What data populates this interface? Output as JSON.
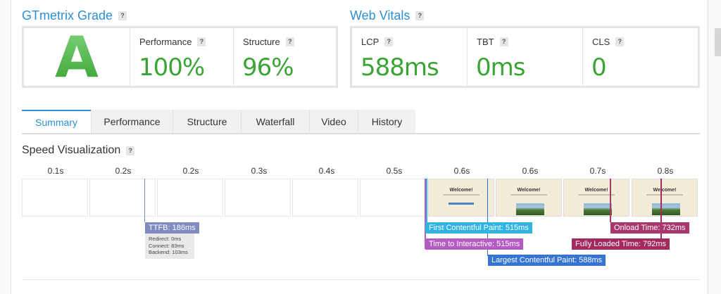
{
  "gtmetrix": {
    "title": "GTmetrix Grade",
    "help": "?",
    "grade": "A",
    "metrics": [
      {
        "label": "Performance",
        "value": "100%"
      },
      {
        "label": "Structure",
        "value": "96%"
      }
    ]
  },
  "vitals": {
    "title": "Web Vitals",
    "help": "?",
    "metrics": [
      {
        "label": "LCP",
        "value": "588ms"
      },
      {
        "label": "TBT",
        "value": "0ms"
      },
      {
        "label": "CLS",
        "value": "0"
      }
    ]
  },
  "tabs": [
    "Summary",
    "Performance",
    "Structure",
    "Waterfall",
    "Video",
    "History"
  ],
  "active_tab": "Summary",
  "speed": {
    "title": "Speed Visualization",
    "help": "?",
    "ticks": [
      "0.1s",
      "0.2s",
      "0.2s",
      "0.3s",
      "0.4s",
      "0.5s",
      "0.6s",
      "0.6s",
      "0.7s",
      "0.8s"
    ],
    "frame_text": "Welcome!",
    "markers": {
      "ttfb": "TTFB: 186ms",
      "ttfb_details": [
        "Redirect: 0ms",
        "Connect: 83ms",
        "Backend: 103ms"
      ],
      "fcp": "First Contentful Paint: 515ms",
      "tti": "Time to Interactive: 515ms",
      "lcp": "Largest Contentful Paint: 588ms",
      "onload": "Onload Time: 732ms",
      "fully_loaded": "Fully Loaded Time: 792ms"
    }
  },
  "colors": {
    "accent": "#2e8fd6",
    "good": "#3aa534",
    "ttfb": "#7e8cc1",
    "fcp": "#31b4e4",
    "tti": "#b55bc4",
    "lcp": "#3574d4",
    "onload": "#a8386c",
    "fully_loaded": "#a3295e"
  }
}
